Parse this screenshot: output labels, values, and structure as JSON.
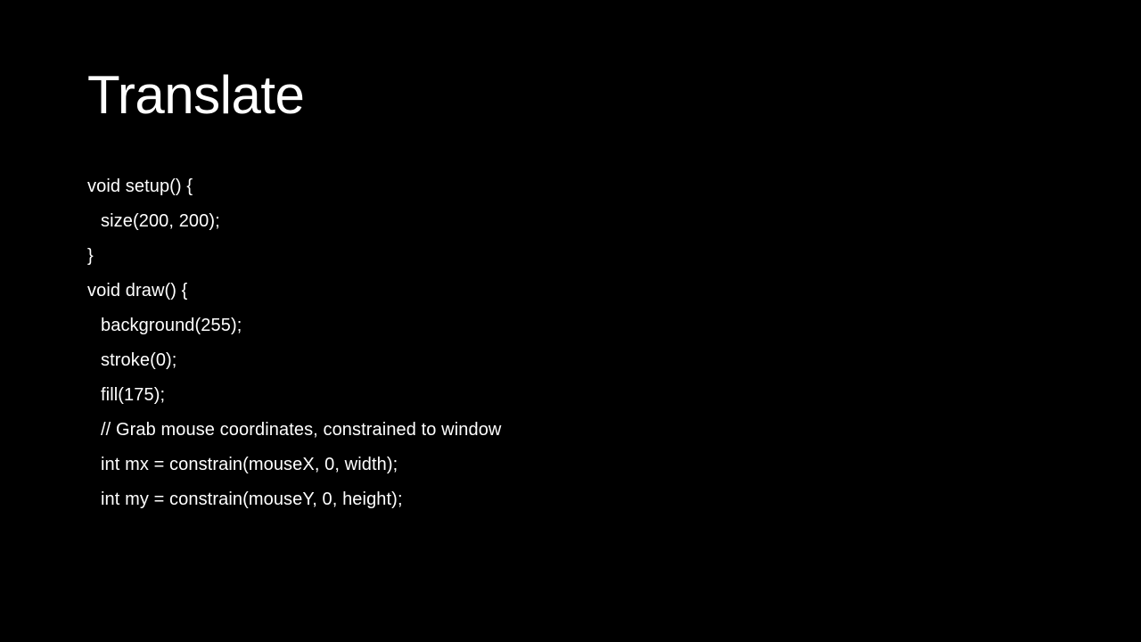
{
  "slide": {
    "title": "Translate",
    "code_lines": [
      {
        "text": "void setup() {",
        "indent": false
      },
      {
        "text": "size(200, 200);",
        "indent": true
      },
      {
        "text": "}",
        "indent": false
      },
      {
        "text": "void draw() {",
        "indent": false
      },
      {
        "text": "background(255);",
        "indent": true
      },
      {
        "text": "stroke(0);",
        "indent": true
      },
      {
        "text": "fill(175);",
        "indent": true
      },
      {
        "text": "// Grab mouse coordinates, constrained to window",
        "indent": true
      },
      {
        "text": "int mx = constrain(mouseX, 0, width);",
        "indent": true
      },
      {
        "text": "int my = constrain(mouseY, 0, height);",
        "indent": true
      }
    ]
  },
  "colors": {
    "background": "#000000",
    "text": "#ffffff"
  }
}
